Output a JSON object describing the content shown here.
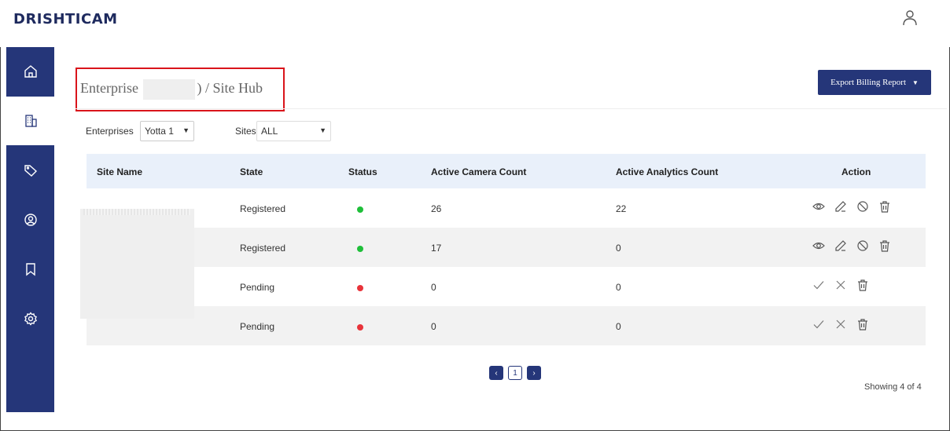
{
  "app": {
    "logo": "DRISHTICAM"
  },
  "sidebar": {
    "items": [
      {
        "icon": "home-icon",
        "active": false
      },
      {
        "icon": "building-icon",
        "active": true
      },
      {
        "icon": "tag-icon",
        "active": false
      },
      {
        "icon": "user-circle-icon",
        "active": false
      },
      {
        "icon": "bookmark-icon",
        "active": false
      },
      {
        "icon": "gear-icon",
        "active": false
      }
    ]
  },
  "header": {
    "breadcrumb_prefix": "Enterprise",
    "breadcrumb_suffix": ") / Site Hub",
    "export_label": "Export Billing Report"
  },
  "filters": {
    "enterprises_label": "Enterprises",
    "enterprises_value": "Yotta 1",
    "sites_label": "Sites",
    "sites_value": "ALL"
  },
  "table": {
    "headers": [
      "Site Name",
      "State",
      "Status",
      "Active Camera Count",
      "Active Analytics Count",
      "Action"
    ],
    "rows": [
      {
        "state": "Registered",
        "status_color": "#1fbf3a",
        "cameras": "26",
        "analytics": "22",
        "actions": "registered"
      },
      {
        "state": "Registered",
        "status_color": "#1fbf3a",
        "cameras": "17",
        "analytics": "0",
        "actions": "registered"
      },
      {
        "state": "Pending",
        "status_color": "#e8333a",
        "cameras": "0",
        "analytics": "0",
        "actions": "pending"
      },
      {
        "state": "Pending",
        "status_color": "#e8333a",
        "cameras": "0",
        "analytics": "0",
        "actions": "pending"
      }
    ]
  },
  "pagination": {
    "prev": "‹",
    "page": "1",
    "next": "›",
    "showing": "Showing 4 of 4"
  },
  "colors": {
    "brand": "#253679",
    "active_status": "#1fbf3a",
    "pending_status": "#e8333a"
  }
}
